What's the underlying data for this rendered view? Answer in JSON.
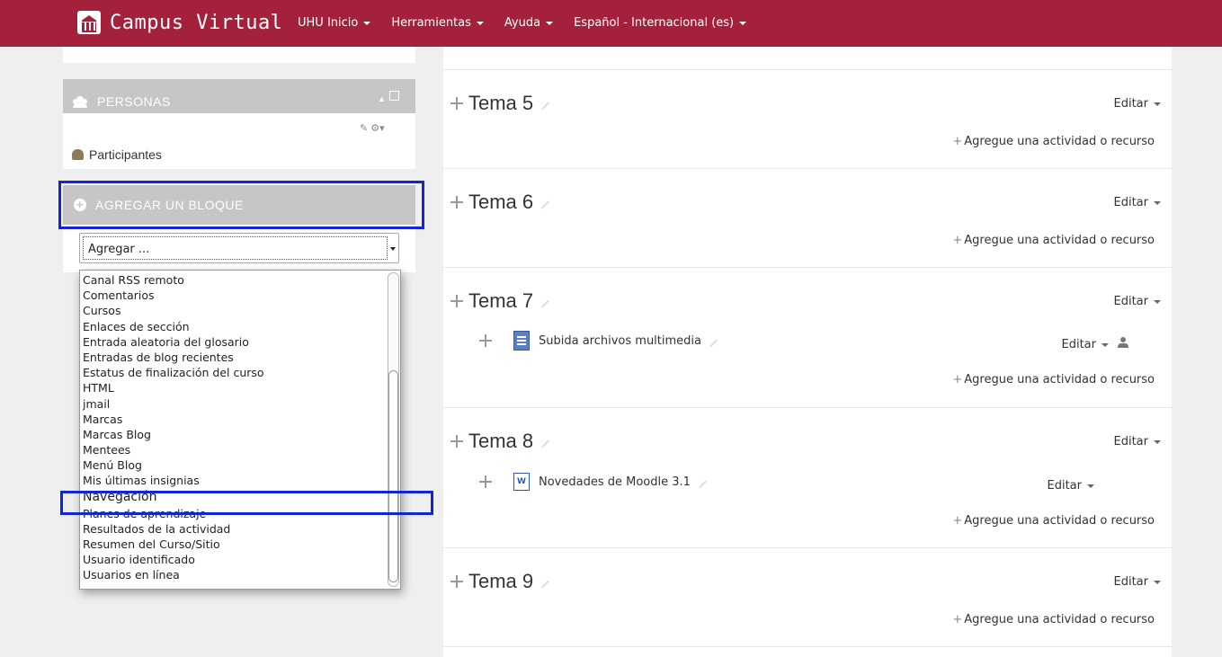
{
  "navbar": {
    "brand": "Campus Virtual",
    "menu": [
      "UHU Inicio",
      "Herramientas",
      "Ayuda",
      "Español - Internacional (es)"
    ]
  },
  "personas_block": {
    "title": "PERSONAS",
    "link": "Participantes"
  },
  "add_block": {
    "title": "AGREGAR UN BLOQUE",
    "select_value": "Agregar ...",
    "options": [
      "Canal RSS remoto",
      "Comentarios",
      "Cursos",
      "Enlaces de sección",
      "Entrada aleatoria del glosario",
      "Entradas de blog recientes",
      "Estatus de finalización del curso",
      "HTML",
      "jmail",
      "Marcas",
      "Marcas Blog",
      "Mentees",
      "Menú Blog",
      "Mis últimas insignias",
      "Navegación",
      "Planes de aprendizaje",
      "Resultados de la actividad",
      "Resumen del Curso/Sitio",
      "Usuario identificado",
      "Usuarios en línea"
    ],
    "highlighted_option": "Navegación"
  },
  "sections": [
    {
      "title": "Tema 5",
      "edit": "Editar",
      "add": "Agregue una actividad o recurso"
    },
    {
      "title": "Tema 6",
      "edit": "Editar",
      "add": "Agregue una actividad o recurso"
    },
    {
      "title": "Tema 7",
      "edit": "Editar",
      "add": "Agregue una actividad o recurso",
      "activity": {
        "name": "Subida archivos multimedia",
        "edit": "Editar"
      }
    },
    {
      "title": "Tema 8",
      "edit": "Editar",
      "add": "Agregue una actividad o recurso",
      "activity": {
        "name": "Novedades de Moodle 3.1",
        "edit": "Editar"
      }
    },
    {
      "title": "Tema 9",
      "edit": "Editar",
      "add": "Agregue una actividad o recurso"
    }
  ],
  "colors": {
    "navbar": "#a3213a",
    "highlight": "#1226d8",
    "block_header": "#c6c6c6"
  }
}
